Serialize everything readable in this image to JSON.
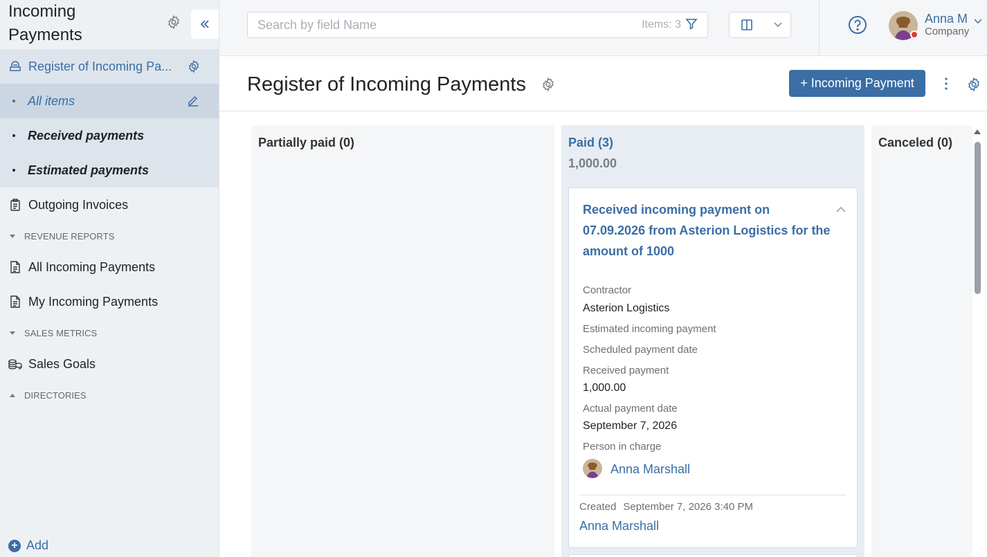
{
  "sidebar": {
    "app_title_line1": "Incoming",
    "app_title_line2": "Payments",
    "items": [
      {
        "label": "Register of Incoming Pa..."
      },
      {
        "label": "All items"
      },
      {
        "label": "Received payments"
      },
      {
        "label": "Estimated payments"
      },
      {
        "label": "Outgoing Invoices"
      }
    ],
    "sections": {
      "revenue_reports": "REVENUE REPORTS",
      "sales_metrics": "SALES METRICS",
      "directories": "DIRECTORIES"
    },
    "revenue_items": [
      {
        "label": "All Incoming Payments"
      },
      {
        "label": "My Incoming Payments"
      }
    ],
    "sales_items": [
      {
        "label": "Sales Goals"
      }
    ],
    "add_label": "Add"
  },
  "topbar": {
    "search_placeholder": "Search by field Name",
    "items_count": "Items: 3",
    "user_name": "Anna M",
    "user_company": "Company"
  },
  "header": {
    "title": "Register of Incoming Payments",
    "primary_button": "+ Incoming Payment"
  },
  "board": {
    "columns": [
      {
        "title": "Partially paid (0)"
      },
      {
        "title": "Paid (3)",
        "sum": "1,000.00"
      },
      {
        "title": "Canceled (0)"
      }
    ],
    "card": {
      "title": "Received incoming payment on 07.09.2026 from Asterion Logistics for the amount of 1000",
      "contractor_label": "Contractor",
      "contractor_value": "Asterion Logistics",
      "estimated_label": "Estimated incoming payment",
      "scheduled_label": "Scheduled payment date",
      "received_label": "Received payment",
      "received_value": "1,000.00",
      "actual_date_label": "Actual payment date",
      "actual_date_value": "September 7, 2026",
      "person_label": "Person in charge",
      "person_value": "Anna Marshall",
      "created_label": "Created",
      "created_value": "September 7, 2026 3:40 PM",
      "creator": "Anna Marshall"
    }
  },
  "colors": {
    "accent": "#3a6ea5",
    "sidebar_bg": "#eef1f4",
    "paid_column_bg": "#e8edf3",
    "neutral_column_bg": "#f5f6f8",
    "status_dot": "#e53935"
  }
}
